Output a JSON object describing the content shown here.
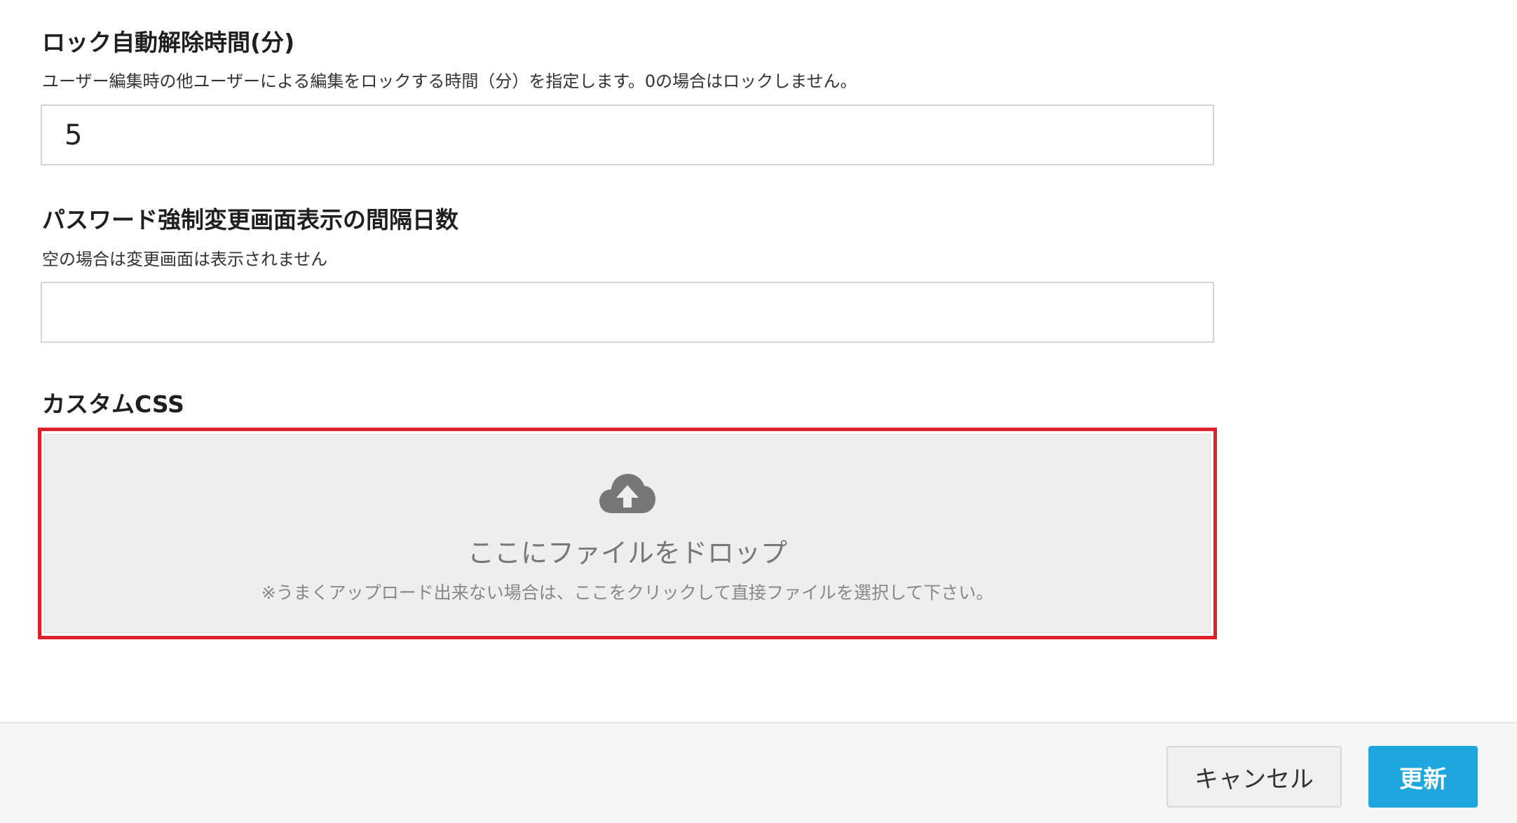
{
  "fields": {
    "lock_time": {
      "label": "ロック自動解除時間(分)",
      "help": "ユーザー編集時の他ユーザーによる編集をロックする時間（分）を指定します。0の場合はロックしません。",
      "value": "5",
      "placeholder": ""
    },
    "password_interval": {
      "label": "パスワード強制変更画面表示の間隔日数",
      "help": "空の場合は変更画面は表示されません",
      "value": "",
      "placeholder": ""
    },
    "custom_css": {
      "label": "カスタムCSS",
      "dropzone": {
        "icon": "cloud-upload-icon",
        "title": "ここにファイルをドロップ",
        "subtitle": "※うまくアップロード出来ない場合は、ここをクリックして直接ファイルを選択して下さい。"
      }
    }
  },
  "footer": {
    "cancel_label": "キャンセル",
    "update_label": "更新"
  },
  "colors": {
    "highlight_border": "#e0202a",
    "primary_button": "#1ea7de",
    "dropzone_bg": "#eeeeee",
    "icon": "#777777"
  }
}
